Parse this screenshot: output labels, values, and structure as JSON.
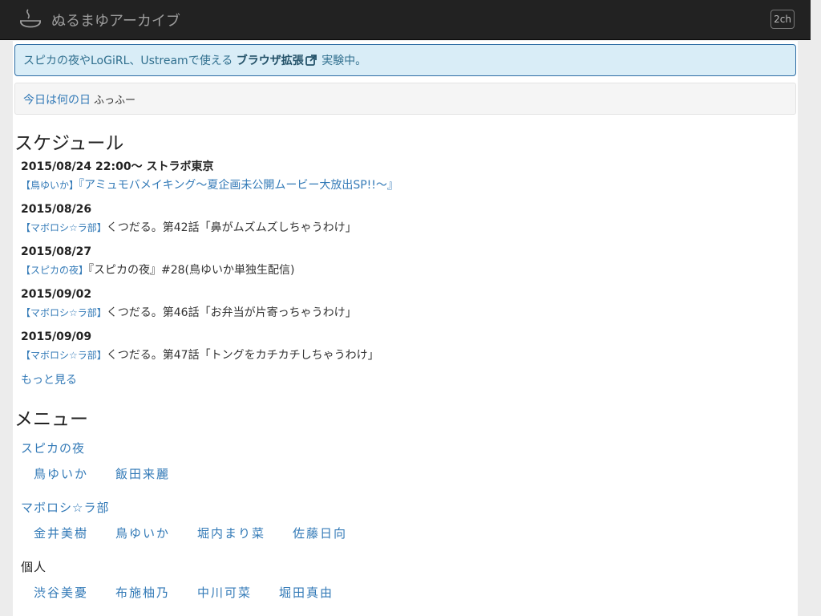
{
  "navbar": {
    "brand_title": "ぬるまゆアーカイブ",
    "right_button": "2ch"
  },
  "alert": {
    "prefix": "スピカの夜やLoGiRL、Ustreamで使える",
    "bold": "ブラウザ拡張",
    "suffix": "実験中。"
  },
  "today": {
    "link": "今日は何の日",
    "sub": "ふっふー"
  },
  "schedule": {
    "heading": "スケジュール",
    "items": [
      {
        "date": "2015/08/24 22:00〜 ストラボ東京",
        "category": "【鳥ゆいか】",
        "title": "『アミュモバメイキング〜夏企画未公開ムービー大放出SP!!〜』",
        "title_is_link": true
      },
      {
        "date": "2015/08/26",
        "category": "【マボロシ☆ラ部】",
        "title": "くつだる。第42話「鼻がムズムズしちゃうわけ」",
        "title_is_link": false
      },
      {
        "date": "2015/08/27",
        "category": "【スピカの夜】",
        "title": "『スピカの夜』#28(鳥ゆいか単独生配信)",
        "title_is_link": false
      },
      {
        "date": "2015/09/02",
        "category": "【マボロシ☆ラ部】",
        "title": "くつだる。第46話「お弁当が片寄っちゃうわけ」",
        "title_is_link": false
      },
      {
        "date": "2015/09/09",
        "category": "【マボロシ☆ラ部】",
        "title": "くつだる。第47話「トングをカチカチしちゃうわけ」",
        "title_is_link": false
      }
    ],
    "more": "もっと見る"
  },
  "menu": {
    "heading": "メニュー",
    "groups": [
      {
        "title": "スピカの夜",
        "link": true,
        "items": [
          "鳥ゆいか",
          "飯田来麗"
        ]
      },
      {
        "title": "マボロシ☆ラ部",
        "link": true,
        "items": [
          "金井美樹",
          "鳥ゆいか",
          "堀内まり菜",
          "佐藤日向"
        ]
      },
      {
        "title": "個人",
        "link": false,
        "items": [
          "渋谷美憂",
          "布施柚乃",
          "中川可菜",
          "堀田真由"
        ]
      }
    ]
  },
  "colors": {
    "link": "#337ab7",
    "navbar_bg": "#222222",
    "alert_bg": "#d9edf7"
  },
  "icons": {
    "brand": "onsen-icon",
    "alert": "external-link-icon"
  }
}
